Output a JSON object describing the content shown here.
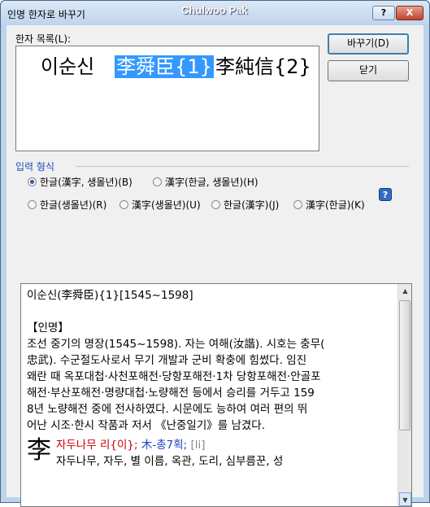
{
  "window": {
    "title": "인명 한자로 바꾸기",
    "watermark": "Chulwoo Pak",
    "help_button": "?",
    "close_button": "X"
  },
  "list": {
    "label": "한자 목록(L):",
    "items": [
      {
        "text": "이순신",
        "selected": false
      },
      {
        "text": "李舜臣{1}",
        "selected": true
      },
      {
        "text": "李純信{2}",
        "selected": false
      }
    ]
  },
  "buttons": {
    "convert": "바꾸기(D)",
    "close": "닫기"
  },
  "input_format": {
    "title": "입력 형식",
    "options": [
      {
        "label": "한글(漢字, 생몰년)(B)",
        "checked": true
      },
      {
        "label": "漢字(한글, 생몰년)(H)",
        "checked": false
      },
      {
        "label": "한글(생몰년)(R)",
        "checked": false
      },
      {
        "label": "漢字(생몰년)(U)",
        "checked": false
      },
      {
        "label": "한글(漢字)(J)",
        "checked": false
      },
      {
        "label": "漢字(한글)(K)",
        "checked": false
      }
    ],
    "help_icon": "?"
  },
  "preview": {
    "heading": "이순신(李舜臣){1}[1545~1598]",
    "section": "【인명】",
    "lines": [
      "조선 중기의 명장(1545~1598). 자는 여해(汝諧). 시호는 충무(",
      "忠武). 수군절도사로서 무기 개발과 군비 확충에 힘썼다. 임진",
      "왜란 때 옥포대첩·사천포해전·당항포해전·1차 당항포해전·안골포",
      "해전·부산포해전·명량대첩·노량해전 등에서 승리를 거두고 159",
      "8년 노량해전 중에 전사하였다. 시문에도 능하여 여러 편의 뛰",
      "어난 시조·한시 작품과 저서 《난중일기》를 남겼다."
    ],
    "entry": {
      "char": "李",
      "reading": "자두나무 리{이};",
      "radical": "木-총7획;",
      "bracket": "[li]",
      "meaning": "자두나무, 자두, 별 이름, 옥관, 도리, 심부름꾼, 성"
    }
  }
}
